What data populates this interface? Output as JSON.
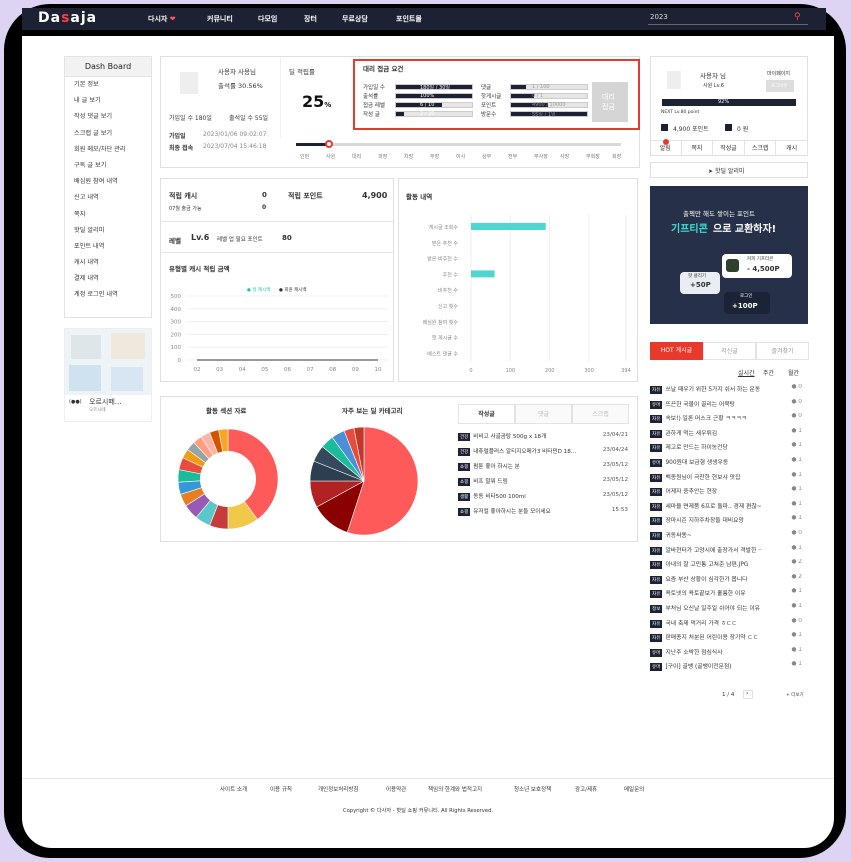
{
  "site": {
    "logo_main": "Dasaja",
    "search_value": "2023"
  },
  "nav": [
    "다시자",
    "커뮤니티",
    "다모임",
    "장터",
    "무료상담",
    "포인트몰"
  ],
  "sidebar": {
    "title": "Dash Board",
    "items": [
      "기본 정보",
      "내 글 보기",
      "작성 댓글 보기",
      "스크랩 글 보기",
      "회원 메모/차단 관리",
      "구독 글 보기",
      "배심원 참여 내역",
      "신고 내역",
      "쪽지",
      "핫딜 알리미",
      "포인트 내역",
      "캐시 내역",
      "결제 내역",
      "계정 로그인 내역"
    ]
  },
  "adbox": {
    "title": "오르시떼...",
    "sub": "오르시떼"
  },
  "profile": {
    "name": "사용자 사용님",
    "attend_label": "출석률",
    "attend": "30.56%",
    "join_days": "가입일 수 180일",
    "attend_days": "출석일 수 55일",
    "joined_label": "가입일",
    "joined": "2023/01/06 09:02:07",
    "last_label": "최종 접속",
    "last": "2023/07/04 15:46:18"
  },
  "accrual": {
    "label": "딜 적립률",
    "value": "25",
    "unit": "%"
  },
  "agent": {
    "title": "대리 접금 요건",
    "rows_left": [
      {
        "label": "가입일 수",
        "text": "180일 / 30일",
        "fill": 1
      },
      {
        "label": "출석률",
        "text": "100%",
        "fill": 1
      },
      {
        "label": "접금 레벨",
        "text": "6 / 10",
        "fill": 0.6
      },
      {
        "label": "작성 글",
        "text": "2 / 20",
        "fill": 0.1
      }
    ],
    "rows_right": [
      {
        "label": "댓글",
        "text": "1 / 100",
        "fill": 0.2
      },
      {
        "label": "핫게시글",
        "text": "0 / 1",
        "fill": 0.3
      },
      {
        "label": "포인트",
        "text": "4900 / 10000",
        "fill": 0.49
      },
      {
        "label": "방문수",
        "text": "55일 / 1일",
        "fill": 1
      }
    ],
    "button": "대리\n접금"
  },
  "levels": [
    "인턴",
    "사원",
    "대리",
    "과장",
    "차장",
    "부장",
    "이사",
    "상무",
    "전무",
    "부사장",
    "사장",
    "부회장",
    "회장"
  ],
  "cash": {
    "label": "적립 캐시",
    "value": "0",
    "sub": "07월 출금 가능",
    "sub_value": "0"
  },
  "point": {
    "label": "적립 포인트",
    "value": "4,900"
  },
  "level": {
    "label": "레벨",
    "value": "Lv.6",
    "need_label": "레벨 업 필요 포인트",
    "need": "80"
  },
  "cashchart": {
    "title": "유형별 캐시 적립 금액",
    "legend": [
      "딜 캐시백",
      "회원 캐시백"
    ]
  },
  "chart_data": [
    {
      "type": "line",
      "title": "유형별 캐시 적립 금액",
      "x": [
        "02",
        "03",
        "04",
        "05",
        "06",
        "07",
        "08",
        "09",
        "10"
      ],
      "ylim": [
        0,
        500
      ],
      "yticks": [
        0,
        100,
        200,
        300,
        400,
        500
      ],
      "series": [
        {
          "name": "딜 캐시백",
          "values": [
            0,
            0,
            0,
            0,
            0,
            0,
            0,
            0,
            0
          ]
        },
        {
          "name": "회원 캐시백",
          "values": [
            0,
            0,
            0,
            0,
            0,
            0,
            0,
            0,
            0
          ]
        }
      ]
    },
    {
      "type": "bar",
      "title": "활동 내역",
      "categories": [
        "게시글 조회수",
        "받은 추천 수",
        "받은 비추천 수",
        "추천 수",
        "비추천 수",
        "신고 횟수",
        "배심원 참여 횟수",
        "핫 게시글 수",
        "베스트 댓글 수"
      ],
      "values": [
        190,
        0,
        0,
        60,
        0,
        0,
        0,
        0,
        0
      ],
      "xticks": [
        0,
        100,
        200,
        300,
        394
      ],
      "xlim": [
        0,
        394
      ]
    },
    {
      "type": "pie",
      "title": "활동 섹션 자료",
      "values": [
        40,
        10,
        6,
        5,
        5,
        4,
        4,
        4,
        4,
        3,
        3,
        3,
        3,
        3,
        3
      ],
      "colors": [
        "#ff5a5a",
        "#f2c84b",
        "#c73b3b",
        "#5ac8c8",
        "#9b59b6",
        "#e67e22",
        "#3498db",
        "#1abc9c",
        "#e74c3c",
        "#f39c12",
        "#95a5a6",
        "#ff9f7f",
        "#ffb3a7",
        "#d35400",
        "#f5a623"
      ]
    },
    {
      "type": "pie",
      "title": "자주 보는 딜 카테고리",
      "values": [
        55,
        12,
        8,
        6,
        5,
        4,
        4,
        3,
        3
      ],
      "colors": [
        "#ff5a5a",
        "#8b0000",
        "#b22222",
        "#2c3e50",
        "#34495e",
        "#1abc9c",
        "#4a90d9",
        "#e74c3c",
        "#c0392b"
      ]
    }
  ],
  "activity": {
    "title": "활동 내역"
  },
  "tabs": [
    "작성글",
    "댓글",
    "스크랩"
  ],
  "recent": [
    {
      "tag": "건강",
      "text": "비비고 사골곰탕 500g x 18개",
      "date": "23/04/21"
    },
    {
      "tag": "건강",
      "text": "내츄럴플러스 알티지오메가3 비타민D 18…",
      "date": "23/04/24"
    },
    {
      "tag": "쇼핑",
      "text": "펌툰 좋아 하시는 분",
      "date": "23/05/12"
    },
    {
      "tag": "쇼핑",
      "text": "비프 말뭐 드림",
      "date": "23/05/12"
    },
    {
      "tag": "생활",
      "text": "동동 비타500 100ml",
      "date": "23/05/12"
    },
    {
      "tag": "쇼핑",
      "text": "유저컬 좋아하시는 분들 모이세요",
      "date": "15:53"
    }
  ],
  "right": {
    "user": "사용자 님",
    "mypage": "마이페이지",
    "level": "사원 Lv.6",
    "logout": "로그아웃",
    "progress": "92%",
    "next": "NEXT Lv.80 point",
    "points": "4,900 포인트",
    "won": "0 원",
    "menu": [
      "알림",
      "쪽지",
      "작성글",
      "스크랩",
      "캐시"
    ],
    "hotdeal": "핫딜 알리미"
  },
  "banner": {
    "line1": "출첵만 해도 쌓이는 포인트",
    "line2a": "기프티콘",
    "line2b": "으로 교환하자!",
    "coffee": "커피 기프티콘",
    "coffee_val": "- 4,500P",
    "hot": "핫 클리기",
    "hot_val": "+50P",
    "login": "로그인",
    "login_val": "+100P"
  },
  "hot": {
    "tabs": [
      "HOT 게시글",
      "저신글",
      "즐겨찾기"
    ],
    "periods": [
      "실시간",
      "주간",
      "월간"
    ],
    "items": [
      {
        "tag": "자유",
        "text": "쓰날 때우기 위한 5가지 쉬서 하는 운동",
        "n": "0"
      },
      {
        "tag": "유머",
        "text": "뜨끈한 국물이 끌리는 어묵탕",
        "n": "0"
      },
      {
        "tag": "자유",
        "text": "속보!) 일론 머스크 근황 ㅋㅋㅋㅋ",
        "n": "0"
      },
      {
        "tag": "자유",
        "text": "관하게 먹는 새우튀김",
        "n": "1"
      },
      {
        "tag": "자유",
        "text": "제고로 만드는 하이농건당",
        "n": "1"
      },
      {
        "tag": "유머",
        "text": "900원대 보금형 생생우동",
        "n": "1"
      },
      {
        "tag": "자유",
        "text": "백종원님이 극찬한 현보샤 맛집",
        "n": "1"
      },
      {
        "tag": "자유",
        "text": "어제자 중추안는 현장",
        "n": "1"
      },
      {
        "tag": "자유",
        "text": "세마을 면제품 6프로 돌파.. 경제 편찮~",
        "n": "1"
      },
      {
        "tag": "자유",
        "text": "장마시즌 지하주차장들 대비요망",
        "n": "1"
      },
      {
        "tag": "자유",
        "text": "귀동싸똥~",
        "n": "0"
      },
      {
        "tag": "자유",
        "text": "알바현터가 고양시에 출장가서 격발한 ··",
        "n": "1"
      },
      {
        "tag": "자유",
        "text": "아내의 잘 고민통 고쳐준 남편.JPG",
        "n": "2"
      },
      {
        "tag": "자유",
        "text": "요즘 부산 상황이 심각한가 봅니다",
        "n": "2"
      },
      {
        "tag": "자유",
        "text": "욕토넷의 욕토끝보가 훌륭한 이유",
        "n": "1"
      },
      {
        "tag": "정보",
        "text": "부처님 오신날 일주일 쉬어야 되는 이유",
        "n": "1"
      },
      {
        "tag": "자유",
        "text": "국내 축제 먹거리 가격 ㅎㄷㄷ",
        "n": "0"
      },
      {
        "tag": "자유",
        "text": "판매종지 처분된 어린이용 장기약 ㄷㄷ",
        "n": "1"
      },
      {
        "tag": "유머",
        "text": "지난주 소박한 점심식사",
        "n": "1"
      },
      {
        "tag": "유머",
        "text": "[구이] 골뱅 (골뱅이전문점)",
        "n": "1"
      }
    ],
    "page": "1 / 4",
    "more": "+ 더보기"
  },
  "footer": {
    "links": [
      "사이트 소개",
      "이용 규칙",
      "개인정보처리방침",
      "이용약관",
      "책임의 한계와 법적고지",
      "청소년 보호정책",
      "광고/제휴",
      "메일문의"
    ],
    "copy": "Copyright © 다사자 - 핫딜 쇼핑 커뮤니티. All Rights Reserved."
  }
}
